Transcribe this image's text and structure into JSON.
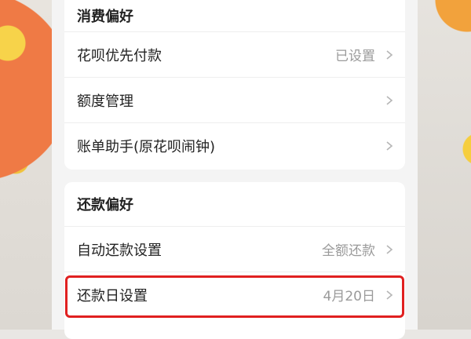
{
  "consumption": {
    "title": "消费偏好",
    "items": [
      {
        "label": "花呗优先付款",
        "value": "已设置"
      },
      {
        "label": "额度管理",
        "value": ""
      },
      {
        "label": "账单助手(原花呗闹钟)",
        "value": ""
      }
    ]
  },
  "repayment": {
    "title": "还款偏好",
    "items": [
      {
        "label": "自动还款设置",
        "value": "全额还款"
      },
      {
        "label": "还款日设置",
        "value": "4月20日"
      }
    ]
  },
  "highlight_color": "#e02020",
  "icons": {
    "row_arrow": "chevron-right-icon"
  }
}
